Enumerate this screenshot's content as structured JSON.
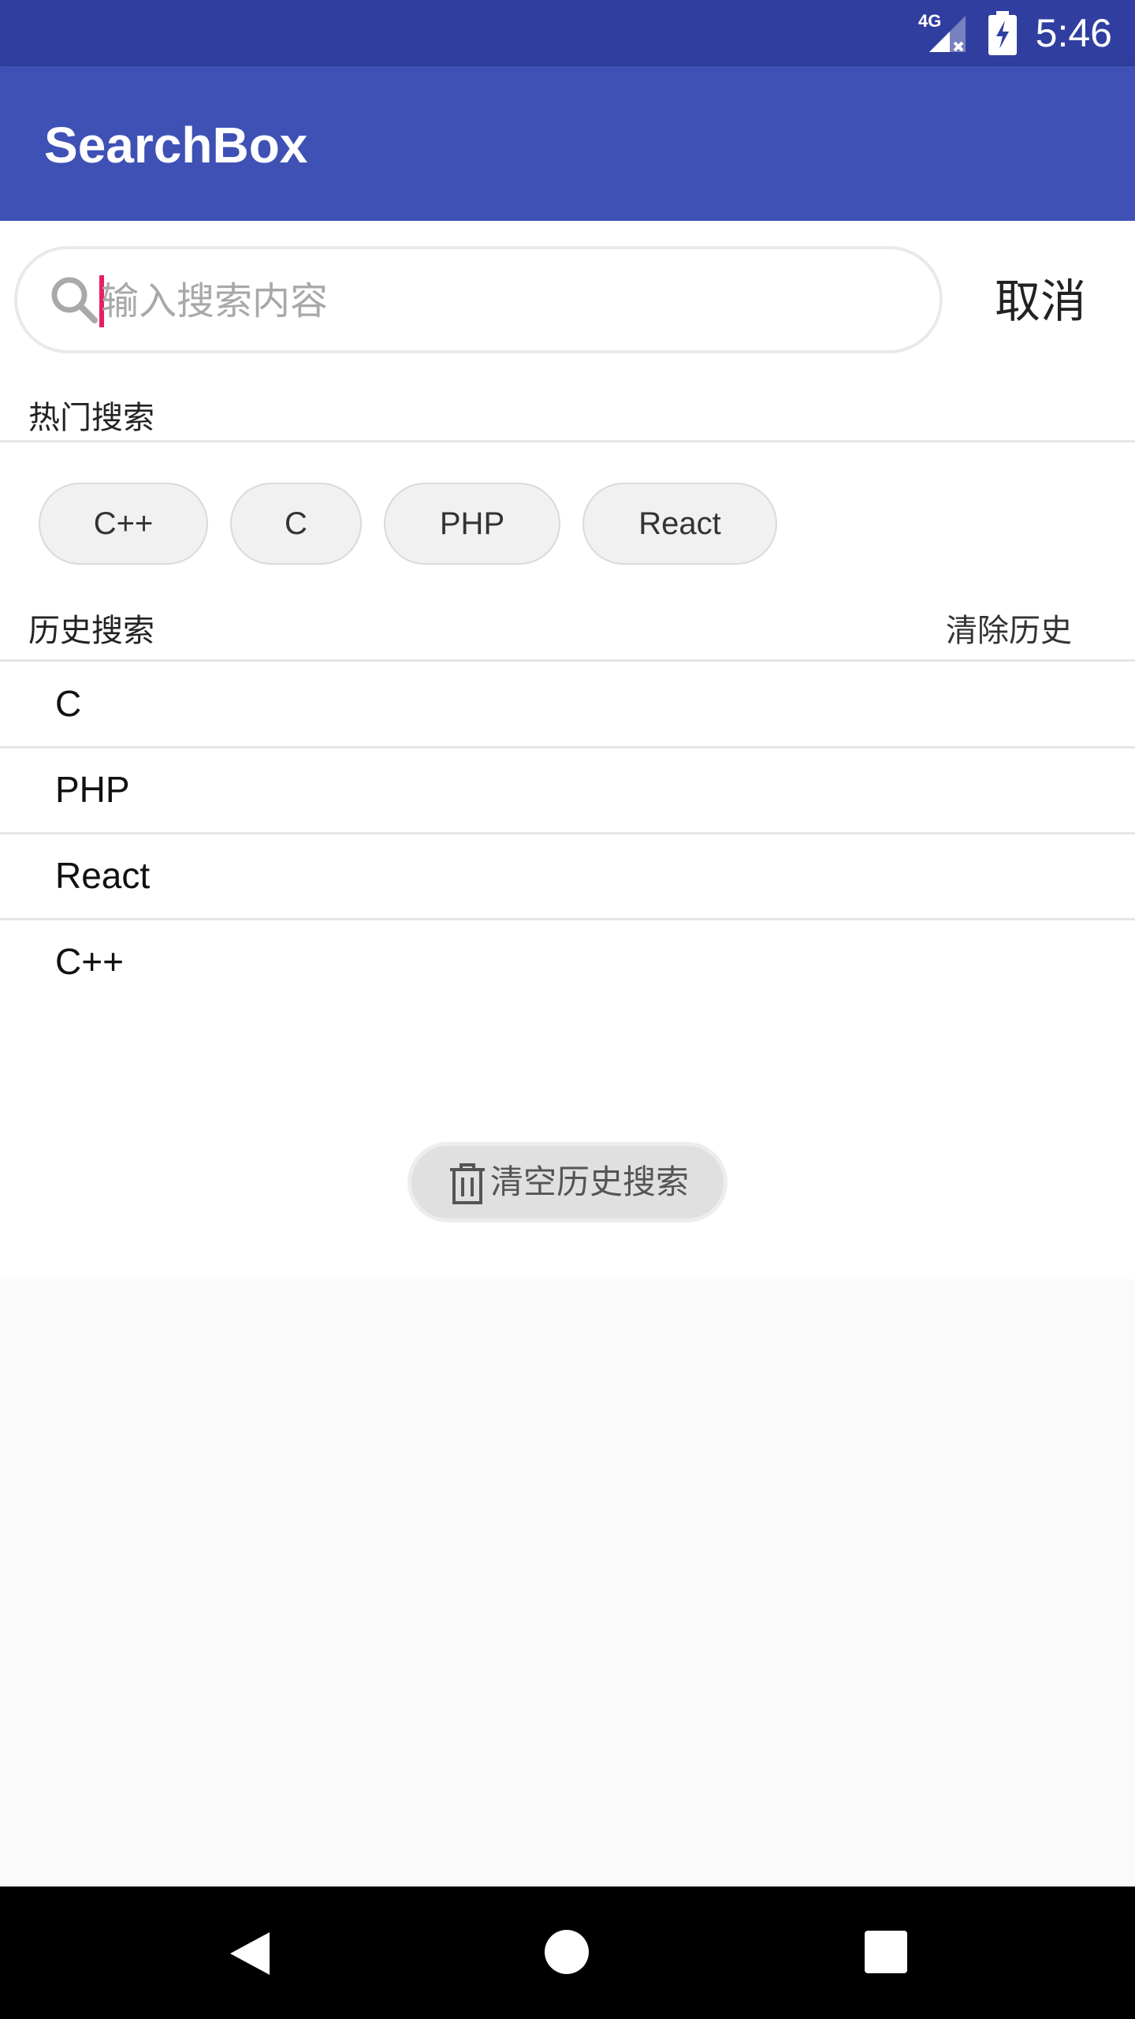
{
  "status_bar": {
    "time": "5:46",
    "network": "4G",
    "icons": [
      "signal-no-data-icon",
      "battery-charging-icon"
    ]
  },
  "app_bar": {
    "title": "SearchBox"
  },
  "search": {
    "placeholder": "输入搜索内容",
    "value": "",
    "icon": "search-icon",
    "cancel_label": "取消"
  },
  "hot_search": {
    "title": "热门搜索",
    "tags": [
      "C++",
      "C",
      "PHP",
      "React"
    ]
  },
  "history": {
    "title": "历史搜索",
    "clear_label": "清除历史",
    "items": [
      "C",
      "PHP",
      "React",
      "C++"
    ],
    "clear_all_label": "清空历史搜索",
    "clear_all_icon": "trash-icon"
  },
  "nav_bar": {
    "icons": [
      "back-icon",
      "home-icon",
      "recents-icon"
    ]
  },
  "colors": {
    "status_bar": "#303f9f",
    "app_bar": "#3f51b5",
    "cursor": "#e91e63"
  }
}
